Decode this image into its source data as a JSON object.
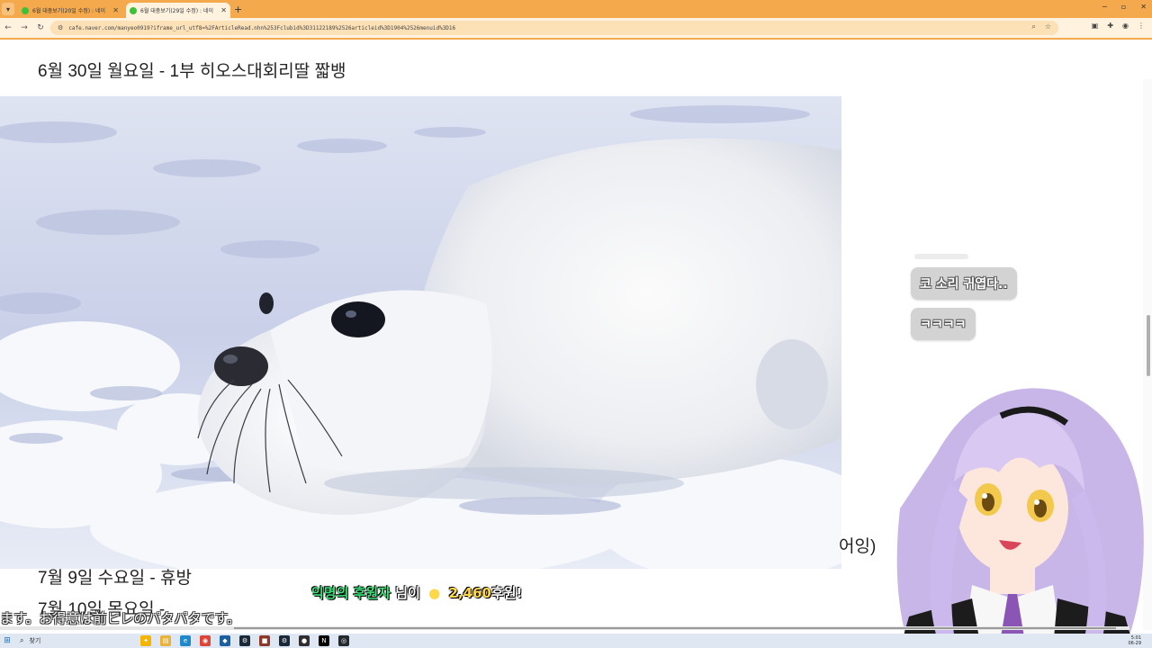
{
  "browser": {
    "tabs": [
      {
        "title": "6월 대충보기(20일 수정) : 네이",
        "active": false
      },
      {
        "title": "6월 대충보기(29일 수정) : 네이",
        "active": true
      }
    ],
    "new_tab_label": "+",
    "url": "cafe.naver.com/manyeo0919?iframe_url_utf8=%2FArticleRead.nhn%253Fclubid%3D31122189%2526articleid%3D1904%2526menuid%3D16",
    "colors": {
      "tab_bar": "#f4a94c",
      "toolbar": "#fff3df",
      "omnibox": "#fce0b6"
    }
  },
  "page": {
    "heading": "6월 30일 월요일 - 1부 히오스대회리딸 짧뱅",
    "photo_subject": "harp seal pup on snow",
    "lines": [
      "7월 9일 수요일 - 휴방",
      "7월 10일 목요일 -"
    ],
    "partial_right_text": "어잉)"
  },
  "chat": [
    {
      "text": "코 소리 귀엽다.."
    },
    {
      "text": "ㅋㅋㅋㅋ"
    }
  ],
  "donation": {
    "donor": "익명의 후원자",
    "suffix": "님이",
    "amount": "2,460",
    "unit": "후원!",
    "colors": {
      "name": "#3ee07a",
      "amount": "#ffd84a"
    }
  },
  "subtitle_jp": "ます。お得意は前ヒレのパタパタです。",
  "taskbar": {
    "search_label": "찾기",
    "icons": [
      "copilot-icon",
      "file-explorer-icon",
      "edge-icon",
      "chrome-icon",
      "app-icon",
      "steam-icon",
      "game-icon",
      "steam-icon-2",
      "obs-icon",
      "notion-icon",
      "github-icon"
    ],
    "clock_time": "5:01",
    "clock_date": "06-29"
  }
}
